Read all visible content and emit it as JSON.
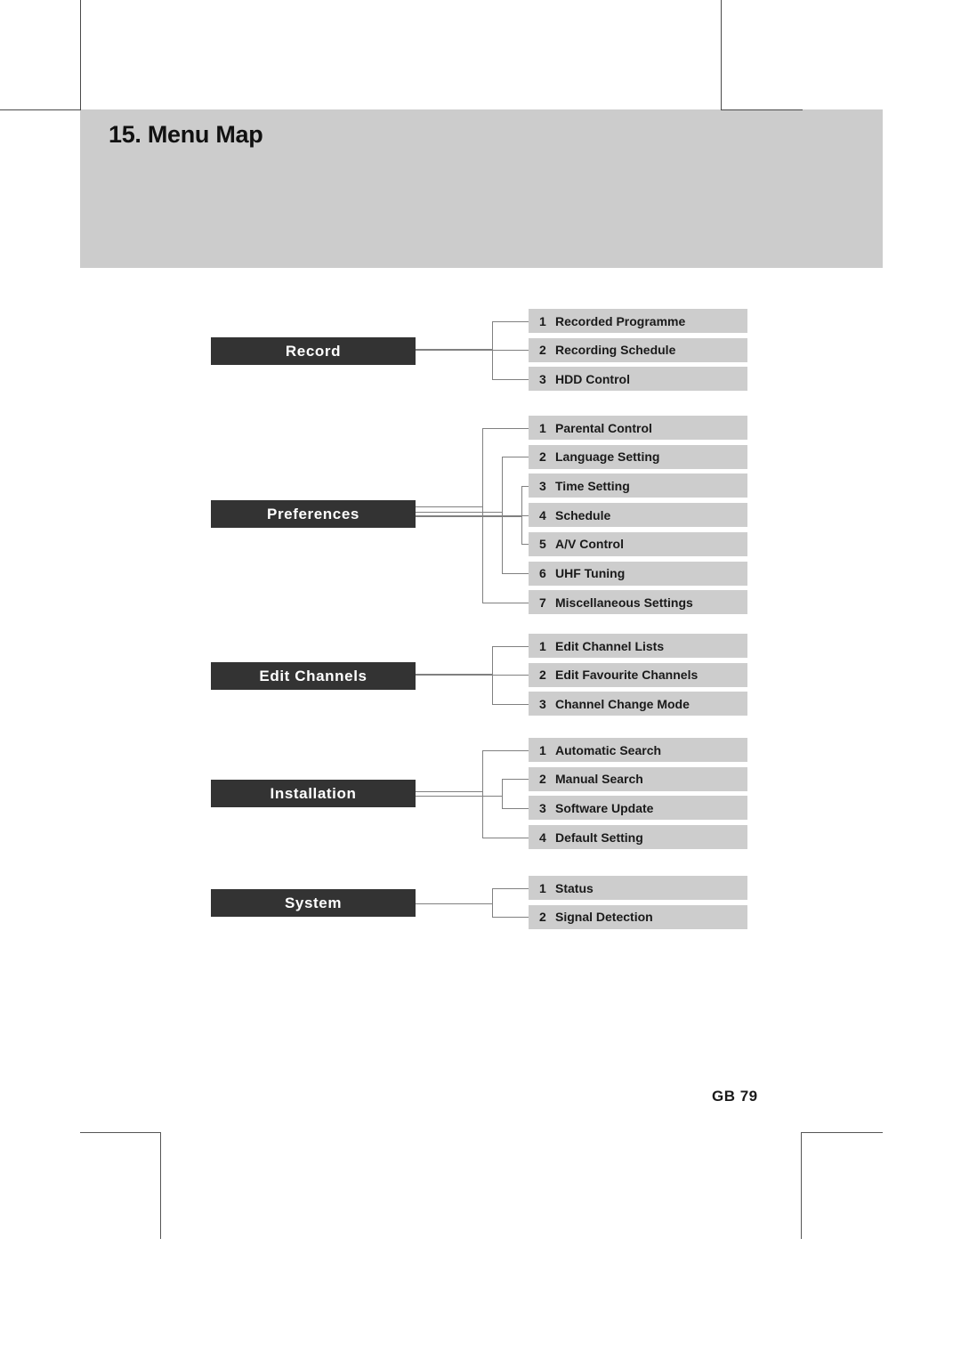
{
  "page": {
    "title": "15. Menu Map",
    "page_number": "GB 79",
    "band_color": "#cccccc",
    "group_color": "#333333",
    "item_color": "#cdcdcd",
    "wire_color": "#808080"
  },
  "diagram": {
    "type": "tree",
    "groups": [
      {
        "name": "Record",
        "items": [
          {
            "num": "1",
            "label": "Recorded Programme"
          },
          {
            "num": "2",
            "label": "Recording Schedule"
          },
          {
            "num": "3",
            "label": "HDD Control"
          }
        ]
      },
      {
        "name": "Preferences",
        "items": [
          {
            "num": "1",
            "label": "Parental Control"
          },
          {
            "num": "2",
            "label": "Language Setting"
          },
          {
            "num": "3",
            "label": "Time Setting"
          },
          {
            "num": "4",
            "label": "Schedule"
          },
          {
            "num": "5",
            "label": "A/V Control"
          },
          {
            "num": "6",
            "label": "UHF Tuning"
          },
          {
            "num": "7",
            "label": "Miscellaneous Settings"
          }
        ]
      },
      {
        "name": "Edit Channels",
        "items": [
          {
            "num": "1",
            "label": "Edit Channel Lists"
          },
          {
            "num": "2",
            "label": "Edit Favourite Channels"
          },
          {
            "num": "3",
            "label": "Channel Change Mode"
          }
        ]
      },
      {
        "name": "Installation",
        "items": [
          {
            "num": "1",
            "label": "Automatic Search"
          },
          {
            "num": "2",
            "label": "Manual Search"
          },
          {
            "num": "3",
            "label": "Software Update"
          },
          {
            "num": "4",
            "label": "Default Setting"
          }
        ]
      },
      {
        "name": "System",
        "items": [
          {
            "num": "1",
            "label": "Status"
          },
          {
            "num": "2",
            "label": "Signal Detection"
          }
        ]
      }
    ]
  }
}
